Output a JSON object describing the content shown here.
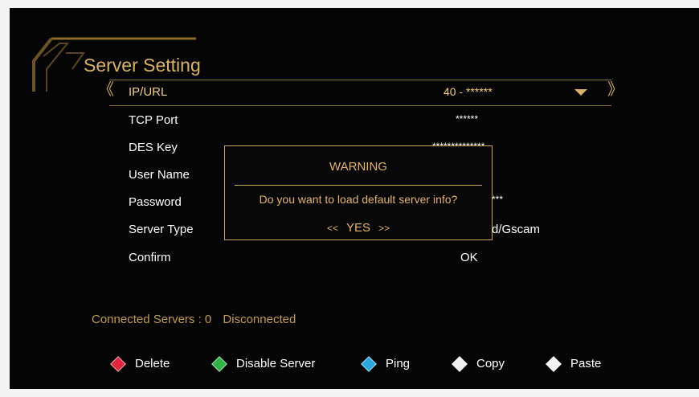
{
  "screen": {
    "title": "Server Setting",
    "nav": {
      "left_arrow": "《",
      "right_arrow": "》"
    },
    "rows": [
      {
        "label": "IP/URL",
        "value": "40 - ******",
        "selected": true
      },
      {
        "label": "TCP Port",
        "value": "******"
      },
      {
        "label": "DES Key",
        "value": "**************"
      },
      {
        "label": "User Name",
        "value": ""
      },
      {
        "label": "Password",
        "value": "***"
      },
      {
        "label": "Server Type",
        "value": "d/Gscam"
      },
      {
        "label": "Confirm",
        "value": "OK"
      }
    ]
  },
  "dialog": {
    "title": "WARNING",
    "message": "Do you want to load default server info?",
    "left_chevron": "<<",
    "button": "YES",
    "right_chevron": ">>"
  },
  "status": {
    "label": "Connected Servers : 0",
    "state": "Disconnected"
  },
  "footer": [
    {
      "icon": "red-diamond-icon",
      "color": "#e0263c",
      "label": "Delete"
    },
    {
      "icon": "green-diamond-icon",
      "color": "#2fb344",
      "label": "Disable Server"
    },
    {
      "icon": "blue-diamond-icon",
      "color": "#2aa7e0",
      "label": "Ping"
    },
    {
      "icon": "white-diamond-icon",
      "color": "#f2f2f2",
      "label": "Copy"
    },
    {
      "icon": "white-diamond-icon",
      "color": "#f2f2f2",
      "label": "Paste"
    }
  ],
  "colors": {
    "accent_gold": "#d7b363",
    "background": "#050505"
  }
}
